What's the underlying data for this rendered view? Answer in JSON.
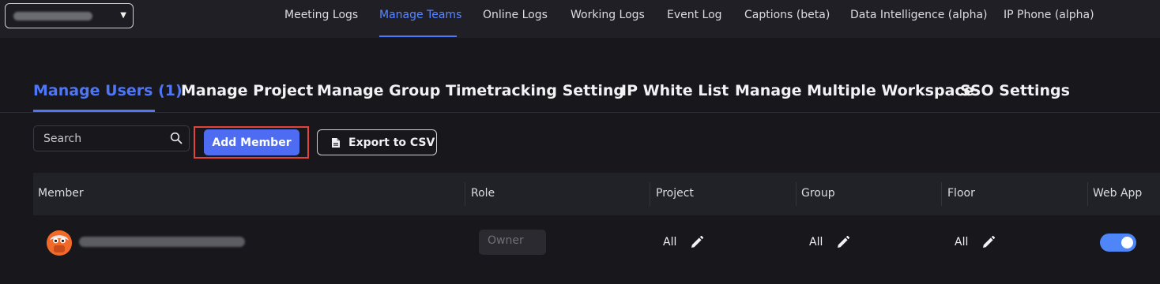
{
  "nav": {
    "links": [
      {
        "label": "Meeting Logs"
      },
      {
        "label": "Manage Teams"
      },
      {
        "label": "Online Logs"
      },
      {
        "label": "Working Logs"
      },
      {
        "label": "Event Log"
      },
      {
        "label": "Captions (beta)"
      },
      {
        "label": "Data Intelligence (alpha)"
      },
      {
        "label": "IP Phone (alpha)"
      }
    ],
    "active_index": 1
  },
  "subtabs": [
    {
      "label": "Manage Users (1)"
    },
    {
      "label": "Manage Project"
    },
    {
      "label": "Manage Group"
    },
    {
      "label": "Timetracking Setting"
    },
    {
      "label": "IP White List"
    },
    {
      "label": "Manage Multiple Workspace"
    },
    {
      "label": "SSO Settings"
    }
  ],
  "toolbar": {
    "search_placeholder": "Search",
    "add_member_label": "Add Member",
    "export_label": "Export to CSV"
  },
  "table": {
    "columns": [
      "Member",
      "Role",
      "Project",
      "Group",
      "Floor",
      "Web App"
    ],
    "rows": [
      {
        "role": "Owner",
        "project": "All",
        "group": "All",
        "floor": "All",
        "web_app_enabled": true
      }
    ]
  },
  "colors": {
    "accent": "#4e76f5",
    "highlight": "#e0443a",
    "toggle_on": "#4f86f7",
    "avatar": "#f26a2a"
  }
}
